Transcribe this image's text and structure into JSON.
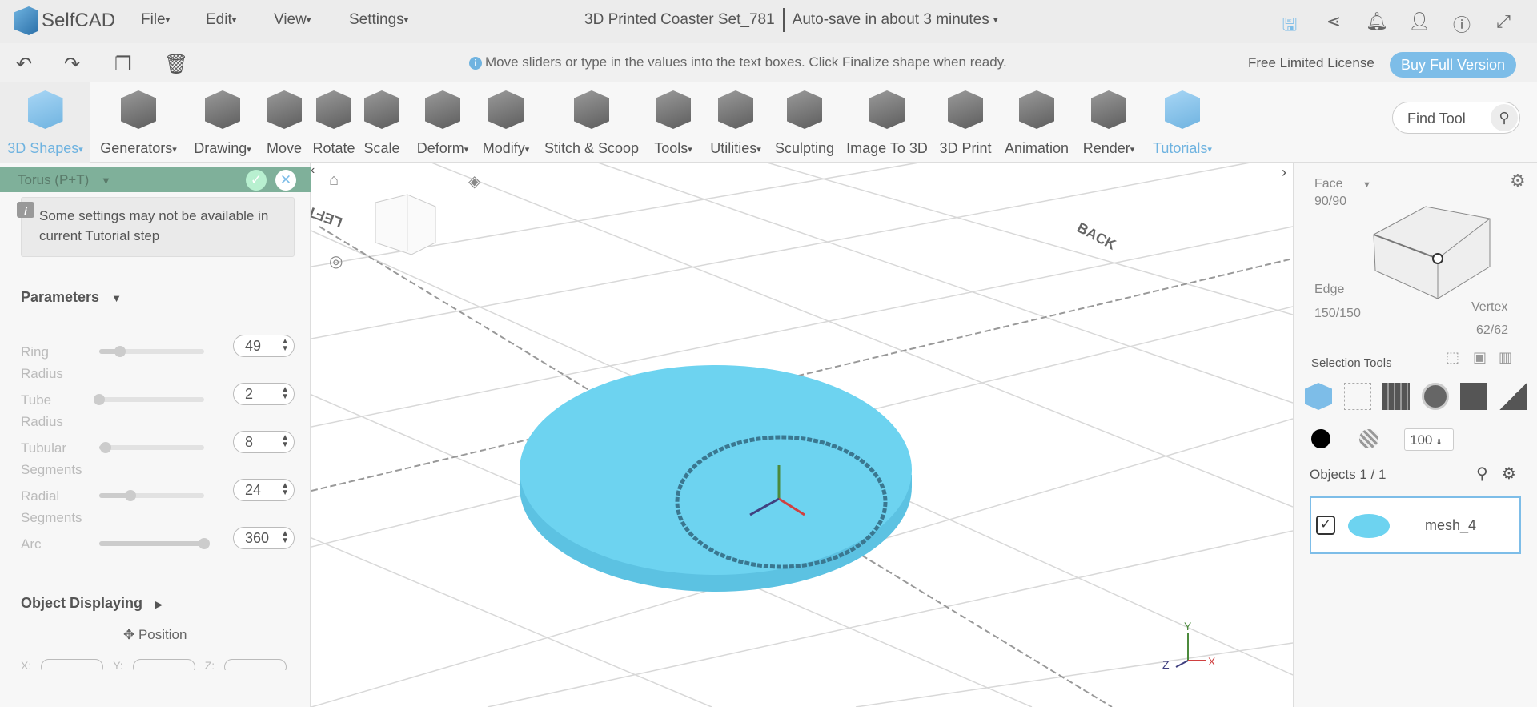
{
  "app": {
    "name": "SelfCAD"
  },
  "menu": [
    "File",
    "Edit",
    "View",
    "Settings"
  ],
  "document": {
    "title": "3D Printed Coaster Set_781",
    "autosave": "Auto-save in about 3 minutes"
  },
  "hint": "Move sliders or type in the values into the text boxes. Click Finalize shape when ready.",
  "license": "Free Limited License",
  "buy": "Buy Full Version",
  "tools": [
    "3D Shapes",
    "Generators",
    "Drawing",
    "Move",
    "Rotate",
    "Scale",
    "Deform",
    "Modify",
    "Stitch & Scoop",
    "Tools",
    "Utilities",
    "Sculpting",
    "Image To 3D",
    "3D Print",
    "Animation",
    "Render",
    "Tutorials"
  ],
  "find_tool": "Find Tool",
  "panel": {
    "title": "Torus (P+T)",
    "notice": "Some settings may not be available in current Tutorial step",
    "parameters_label": "Parameters",
    "params": [
      {
        "label": "Ring Radius",
        "value": "49",
        "fraction": 0.2
      },
      {
        "label": "Tube Radius",
        "value": "2",
        "fraction": 0.0
      },
      {
        "label": "Tubular Segments",
        "value": "8",
        "fraction": 0.06
      },
      {
        "label": "Radial Segments",
        "value": "24",
        "fraction": 0.3
      },
      {
        "label": "Arc",
        "value": "360",
        "fraction": 1.0
      }
    ],
    "object_displaying": "Object Displaying",
    "position": "Position",
    "axes": [
      "X:",
      "Y:",
      "Z:"
    ]
  },
  "viewport": {
    "labels": {
      "back": "BACK",
      "left": "LEFT"
    },
    "axis": {
      "x": "X",
      "y": "Y",
      "z": "Z"
    },
    "colors": {
      "mesh": "#6dd3f0"
    }
  },
  "right": {
    "face_label": "Face",
    "face_count": "90/90",
    "edge_label": "Edge",
    "edge_count": "150/150",
    "vertex_label": "Vertex",
    "vertex_count": "62/62",
    "selection_tools": "Selection Tools",
    "opacity": "100",
    "objects": "Objects 1 / 1",
    "object_name": "mesh_4"
  }
}
